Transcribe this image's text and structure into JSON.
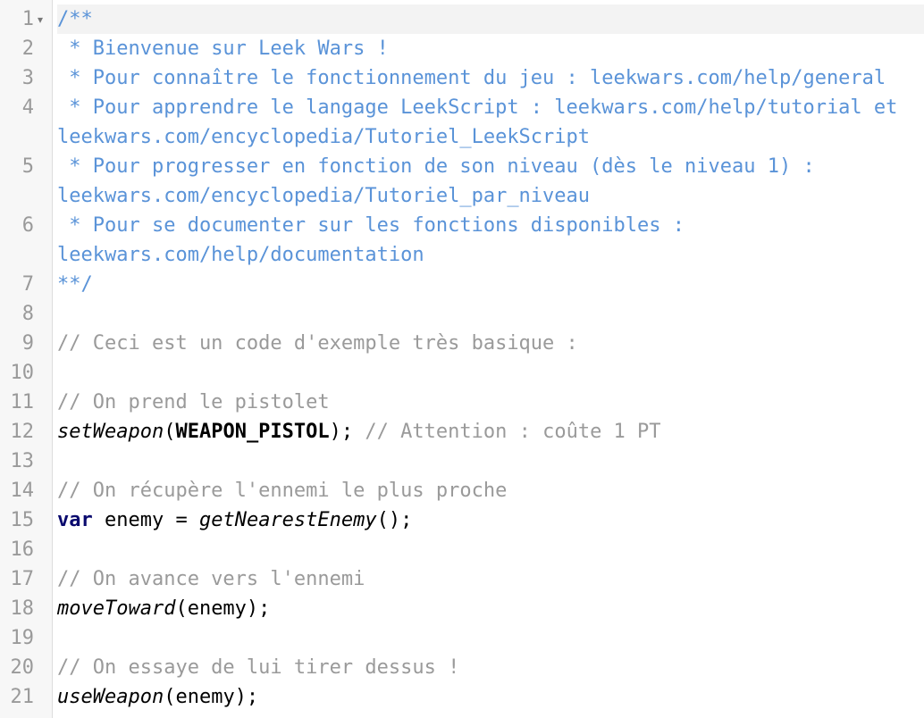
{
  "editor": {
    "lines": [
      {
        "num": "1",
        "text": "/**"
      },
      {
        "num": "2",
        "text": " * Bienvenue sur Leek Wars !"
      },
      {
        "num": "3",
        "text": " * Pour connaître le fonctionnement du jeu : leekwars.com/help/general"
      },
      {
        "num": "4",
        "text": " * Pour apprendre le langage LeekScript : leekwars.com/help/tutorial et",
        "wrap": "leekwars.com/encyclopedia/Tutoriel_LeekScript"
      },
      {
        "num": "5",
        "text": " * Pour progresser en fonction de son niveau (dès le niveau 1) :",
        "wrap": "leekwars.com/encyclopedia/Tutoriel_par_niveau"
      },
      {
        "num": "6",
        "text": " * Pour se documenter sur les fonctions disponibles :",
        "wrap": "leekwars.com/help/documentation"
      },
      {
        "num": "7",
        "text": "**/"
      },
      {
        "num": "8"
      },
      {
        "num": "9",
        "comment": "// Ceci est un code d'exemple très basique :"
      },
      {
        "num": "10"
      },
      {
        "num": "11",
        "comment": "// On prend le pistolet"
      },
      {
        "num": "12",
        "fn": "setWeapon",
        "p1": "(",
        "const": "WEAPON_PISTOL",
        "p2": "); ",
        "comment": "// Attention : coûte 1 PT"
      },
      {
        "num": "13"
      },
      {
        "num": "14",
        "comment": "// On récupère l'ennemi le plus proche"
      },
      {
        "num": "15",
        "kw": "var",
        "p1": " enemy = ",
        "fn": "getNearestEnemy",
        "p2": "();"
      },
      {
        "num": "16"
      },
      {
        "num": "17",
        "comment": "// On avance vers l'ennemi"
      },
      {
        "num": "18",
        "fn": "moveToward",
        "p1": "(enemy);"
      },
      {
        "num": "19"
      },
      {
        "num": "20",
        "comment": "// On essaye de lui tirer dessus !"
      },
      {
        "num": "21",
        "fn": "useWeapon",
        "p1": "(enemy);"
      }
    ],
    "fold_marker": "▾"
  }
}
